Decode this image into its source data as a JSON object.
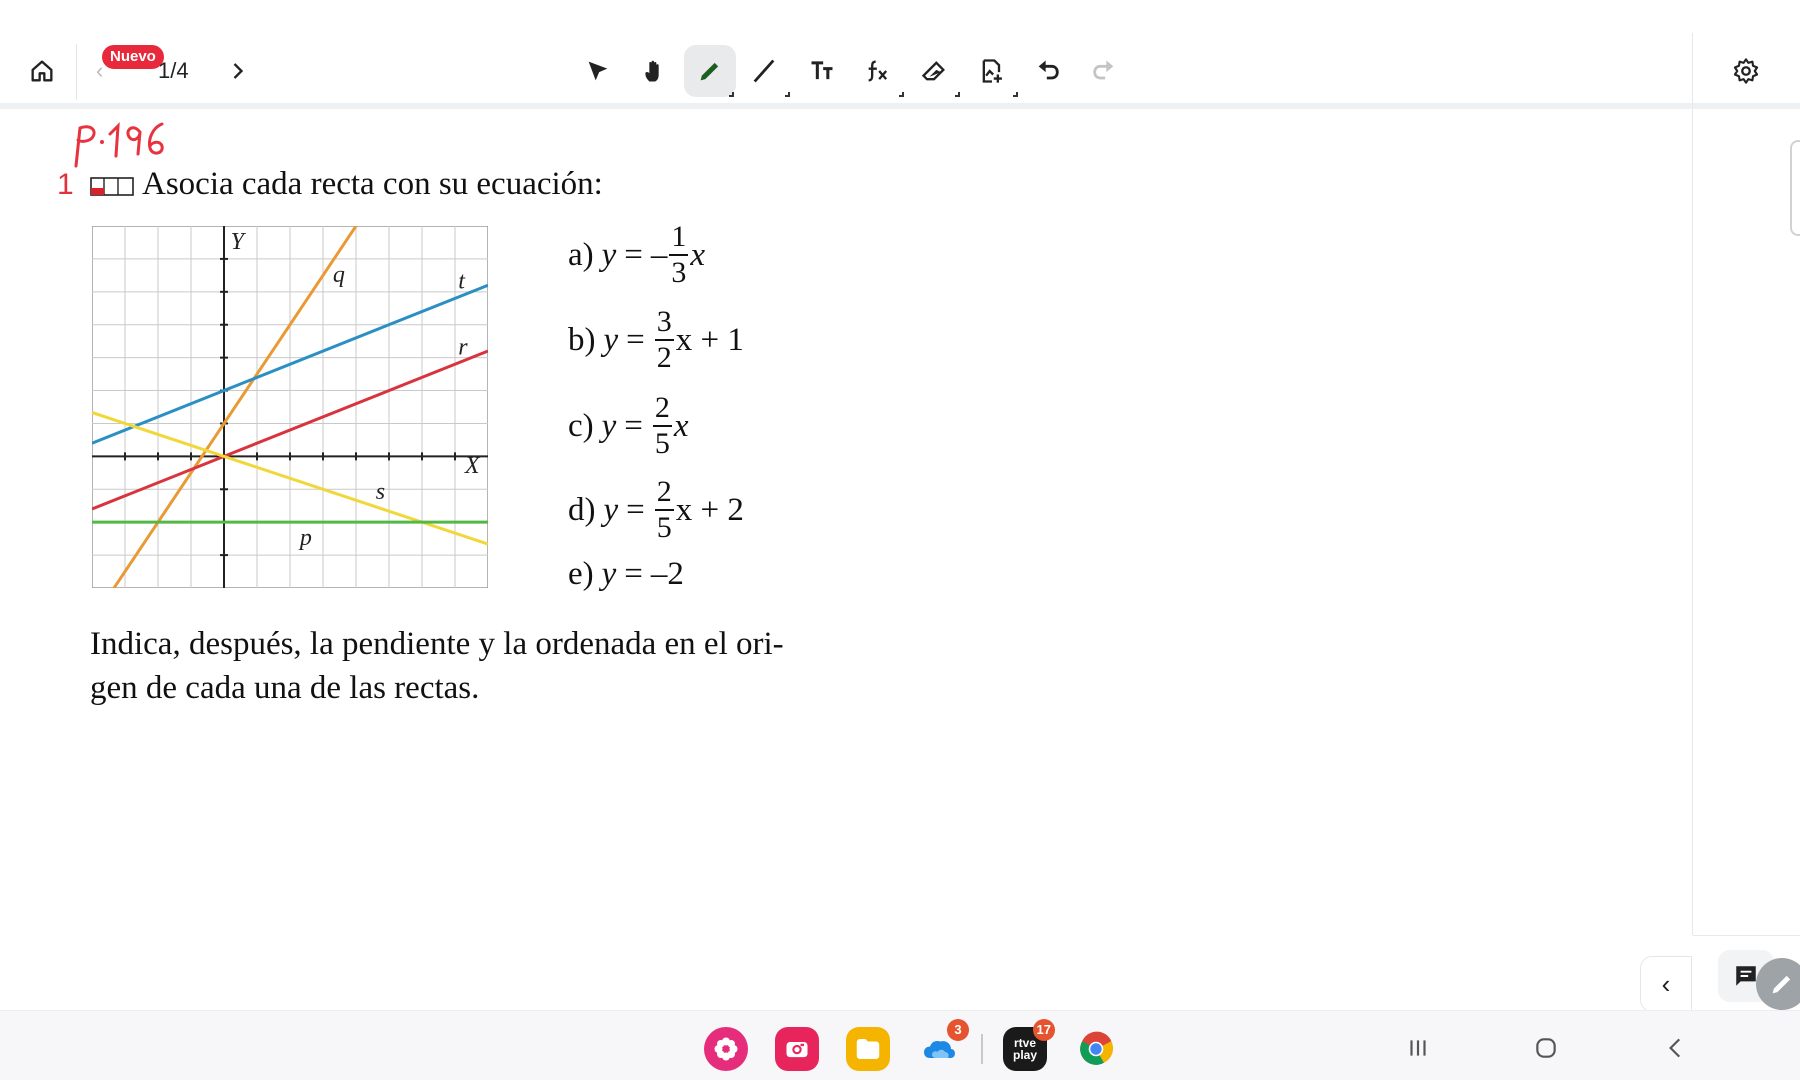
{
  "toolbar": {
    "badge": "Nuevo",
    "page_indicator": "1/4",
    "tools": [
      "home-icon",
      "chevron-left-icon",
      "chevron-right-icon",
      "select-arrow-icon",
      "hand-icon",
      "pen-icon",
      "line-icon",
      "text-icon",
      "formula-icon",
      "eraser-icon",
      "insert-image-icon",
      "undo-icon",
      "redo-icon",
      "gear-icon"
    ],
    "active_tool": "pen-icon"
  },
  "document": {
    "handwritten_note": "p.196",
    "exercise_number": "1",
    "title": "Asocia cada recta con su ecuación:",
    "graph": {
      "axis_labels": {
        "y": "Y",
        "x": "X"
      },
      "line_labels": [
        "q",
        "t",
        "r",
        "s",
        "p"
      ],
      "colors": {
        "q": "#e89a34",
        "t": "#2b8fc4",
        "r": "#d9343e",
        "s": "#f0d83a",
        "p": "#52b848"
      }
    },
    "equations": [
      {
        "label": "a)",
        "lhs": "y",
        "eq": "=",
        "sign": "–",
        "num": "1",
        "den": "3",
        "tail": "x"
      },
      {
        "label": "b)",
        "lhs": "y",
        "eq": "=",
        "sign": "",
        "num": "3",
        "den": "2",
        "tail": "x + 1"
      },
      {
        "label": "c)",
        "lhs": "y",
        "eq": "=",
        "sign": "",
        "num": "2",
        "den": "5",
        "tail": "x"
      },
      {
        "label": "d)",
        "lhs": "y",
        "eq": "=",
        "sign": "",
        "num": "2",
        "den": "5",
        "tail": "x + 2"
      },
      {
        "label": "e)",
        "lhs": "y",
        "eq": "=",
        "value": "–2"
      }
    ],
    "instruction_line1": "Indica, después, la pendiente y la ordenada en el ori-",
    "instruction_line2": "gen de cada una de las rectas."
  },
  "dock": {
    "apps": [
      {
        "name": "blossom-app-icon",
        "color": "#e52d7b"
      },
      {
        "name": "camera-app-icon",
        "color": "#e8245c"
      },
      {
        "name": "files-app-icon",
        "color": "#f5b400"
      },
      {
        "name": "cloud-app-icon",
        "color": "#ffffff",
        "badge": "3"
      },
      {
        "name": "rtve-play-app-icon",
        "color": "#1a1a1a",
        "badge": "17",
        "text": "rtve play"
      },
      {
        "name": "chrome-app-icon",
        "color": "#ffffff"
      }
    ],
    "system": [
      "recents-icon",
      "home-circle-icon",
      "back-icon"
    ]
  }
}
